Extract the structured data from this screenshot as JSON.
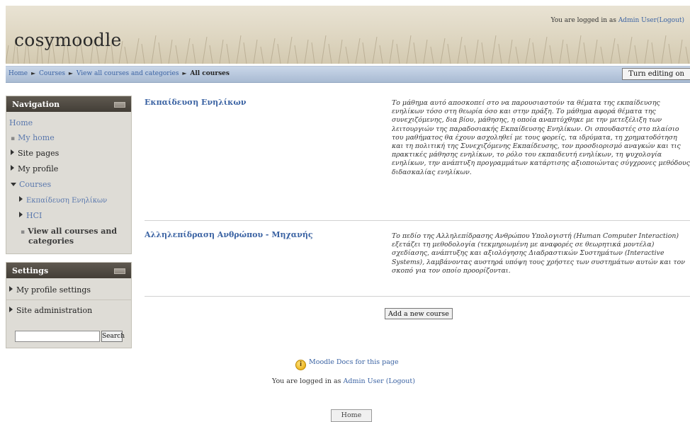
{
  "header": {
    "site_title": "cosymoodle",
    "login_prefix": "You are logged in as ",
    "user_name": "Admin User",
    "logout_label": "(Logout)"
  },
  "breadcrumb": {
    "items": [
      "Home",
      "Courses",
      "View all courses and categories"
    ],
    "current": "All courses",
    "editing_button": "Turn editing on"
  },
  "navigation": {
    "title": "Navigation",
    "home": "Home",
    "my_home": "My home",
    "site_pages": "Site pages",
    "my_profile": "My profile",
    "courses": "Courses",
    "course_items": [
      "Εκπαίδευση Ενηλίκων",
      "HCI"
    ],
    "view_all_line1": "View all courses and",
    "view_all_line2": "categories"
  },
  "settings": {
    "title": "Settings",
    "my_profile_settings": "My profile settings",
    "site_administration": "Site administration",
    "search_placeholder": "",
    "search_button": "Search"
  },
  "courses": [
    {
      "name": "Εκπαίδευση Ενηλίκων",
      "summary": "Το μάθημα αυτό αποσκοπεί στο να παρουσιαστούν τα θέματα της εκπαίδευσης ενηλίκων τόσο στη θεωρία όσο και στην πράξη. Το μάθημα αφορά θέματα της συνεχιζόμενης, δια βίου, μάθησης, η οποία αναπτύχθηκε με την μετεξέλιξη των λειτουργιών της παραδοσιακής Εκπαίδευσης Ενηλίκων. Οι σπουδαστές στο πλαίσιο του μαθήματος θα έχουν ασχοληθεί με τους φορείς, τα ιδρύματα, τη χρηματοδότηση και τη πολιτική της Συνεχιζόμενης Εκπαίδευσης, τον προσδιορισμό αναγκών και τις πρακτικές μάθησης ενηλίκων, το ρόλο του εκπαιδευτή ενηλίκων, τη ψυχολογία ενηλίκων, την ανάπτυξη προγραμμάτων κατάρτισης αξιοποιώντας σύγχρονες μεθόδους διδασκαλίας ενηλίκων."
    },
    {
      "name": "Αλληλεπίδραση Ανθρώπου - Μηχανής",
      "summary": "Το πεδίο της Αλληλεπίδρασης Ανθρώπου Υπολογιστή (Human Computer Interaction) εξετάζει τη μεθοδολογία (τεκμηριωμένη με αναφορές σε θεωρητικά μοντέλα) σχεδίασης, ανάπτυξης και αξιολόγησης Διαδραστικών Συστημάτων (Interactive Systems), λαμβάνοντας αυστηρά υπόψη τους χρήστες των συστημάτων αυτών και τον σκοπό για τον οποίο προορίζονται."
    }
  ],
  "add_course_button": "Add a new course",
  "footer": {
    "docs_link": "Moodle Docs for this page",
    "login_prefix": "You are logged in as ",
    "user_name": "Admin User",
    "logout_label": "(Logout)",
    "home_button": "Home"
  },
  "icons": {
    "info": "info-icon",
    "breadcrumb_separator": "triangle-right-icon",
    "block_hide": "block-hide-icon"
  },
  "colors": {
    "link": "#3b63a3",
    "block_header": "#4a453e",
    "navbar": "#b8c8dd",
    "header_bg": "#ded6c1"
  }
}
